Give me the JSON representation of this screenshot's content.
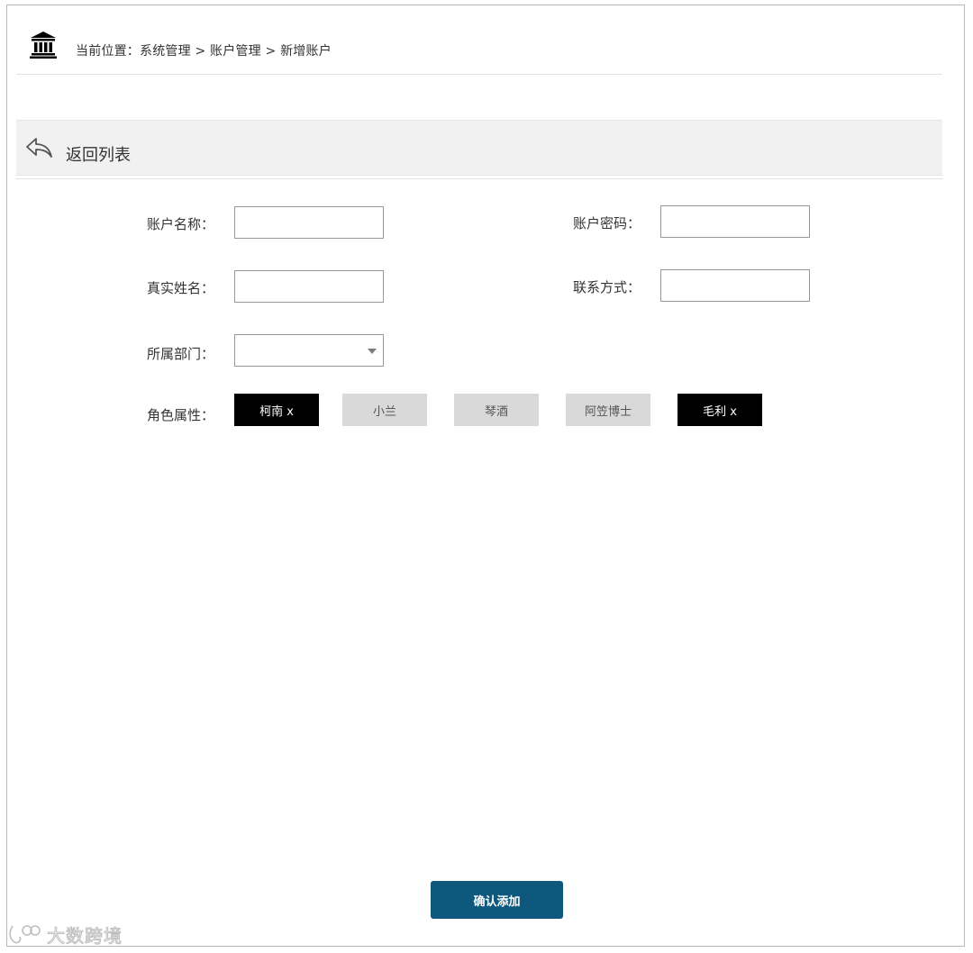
{
  "breadcrumb": {
    "prefix": "当前位置：",
    "items": [
      "系统管理",
      "账户管理",
      "新增账户"
    ],
    "separator": " > "
  },
  "back": {
    "label": "返回列表"
  },
  "form": {
    "account_name": {
      "label": "账户名称：",
      "value": ""
    },
    "account_password": {
      "label": "账户密码：",
      "value": ""
    },
    "real_name": {
      "label": "真实姓名：",
      "value": ""
    },
    "contact": {
      "label": "联系方式：",
      "value": ""
    },
    "department": {
      "label": "所属部门：",
      "value": ""
    },
    "roles": {
      "label": "角色属性：",
      "tags": [
        {
          "label": "柯南 x",
          "selected": true
        },
        {
          "label": "小兰",
          "selected": false
        },
        {
          "label": "琴酒",
          "selected": false
        },
        {
          "label": "阿笠博士",
          "selected": false
        },
        {
          "label": "毛利 x",
          "selected": true
        }
      ]
    }
  },
  "submit": {
    "label": "确认添加"
  },
  "watermark": {
    "text": "大数跨境"
  },
  "colors": {
    "primary": "#0e587e",
    "tag_selected": "#000000",
    "tag_unselected": "#d9d9d9",
    "back_bar": "#f1f1f1"
  },
  "icons": {
    "home": "bank-icon",
    "back": "reply-arrow-icon",
    "watermark": "logo-icon"
  }
}
